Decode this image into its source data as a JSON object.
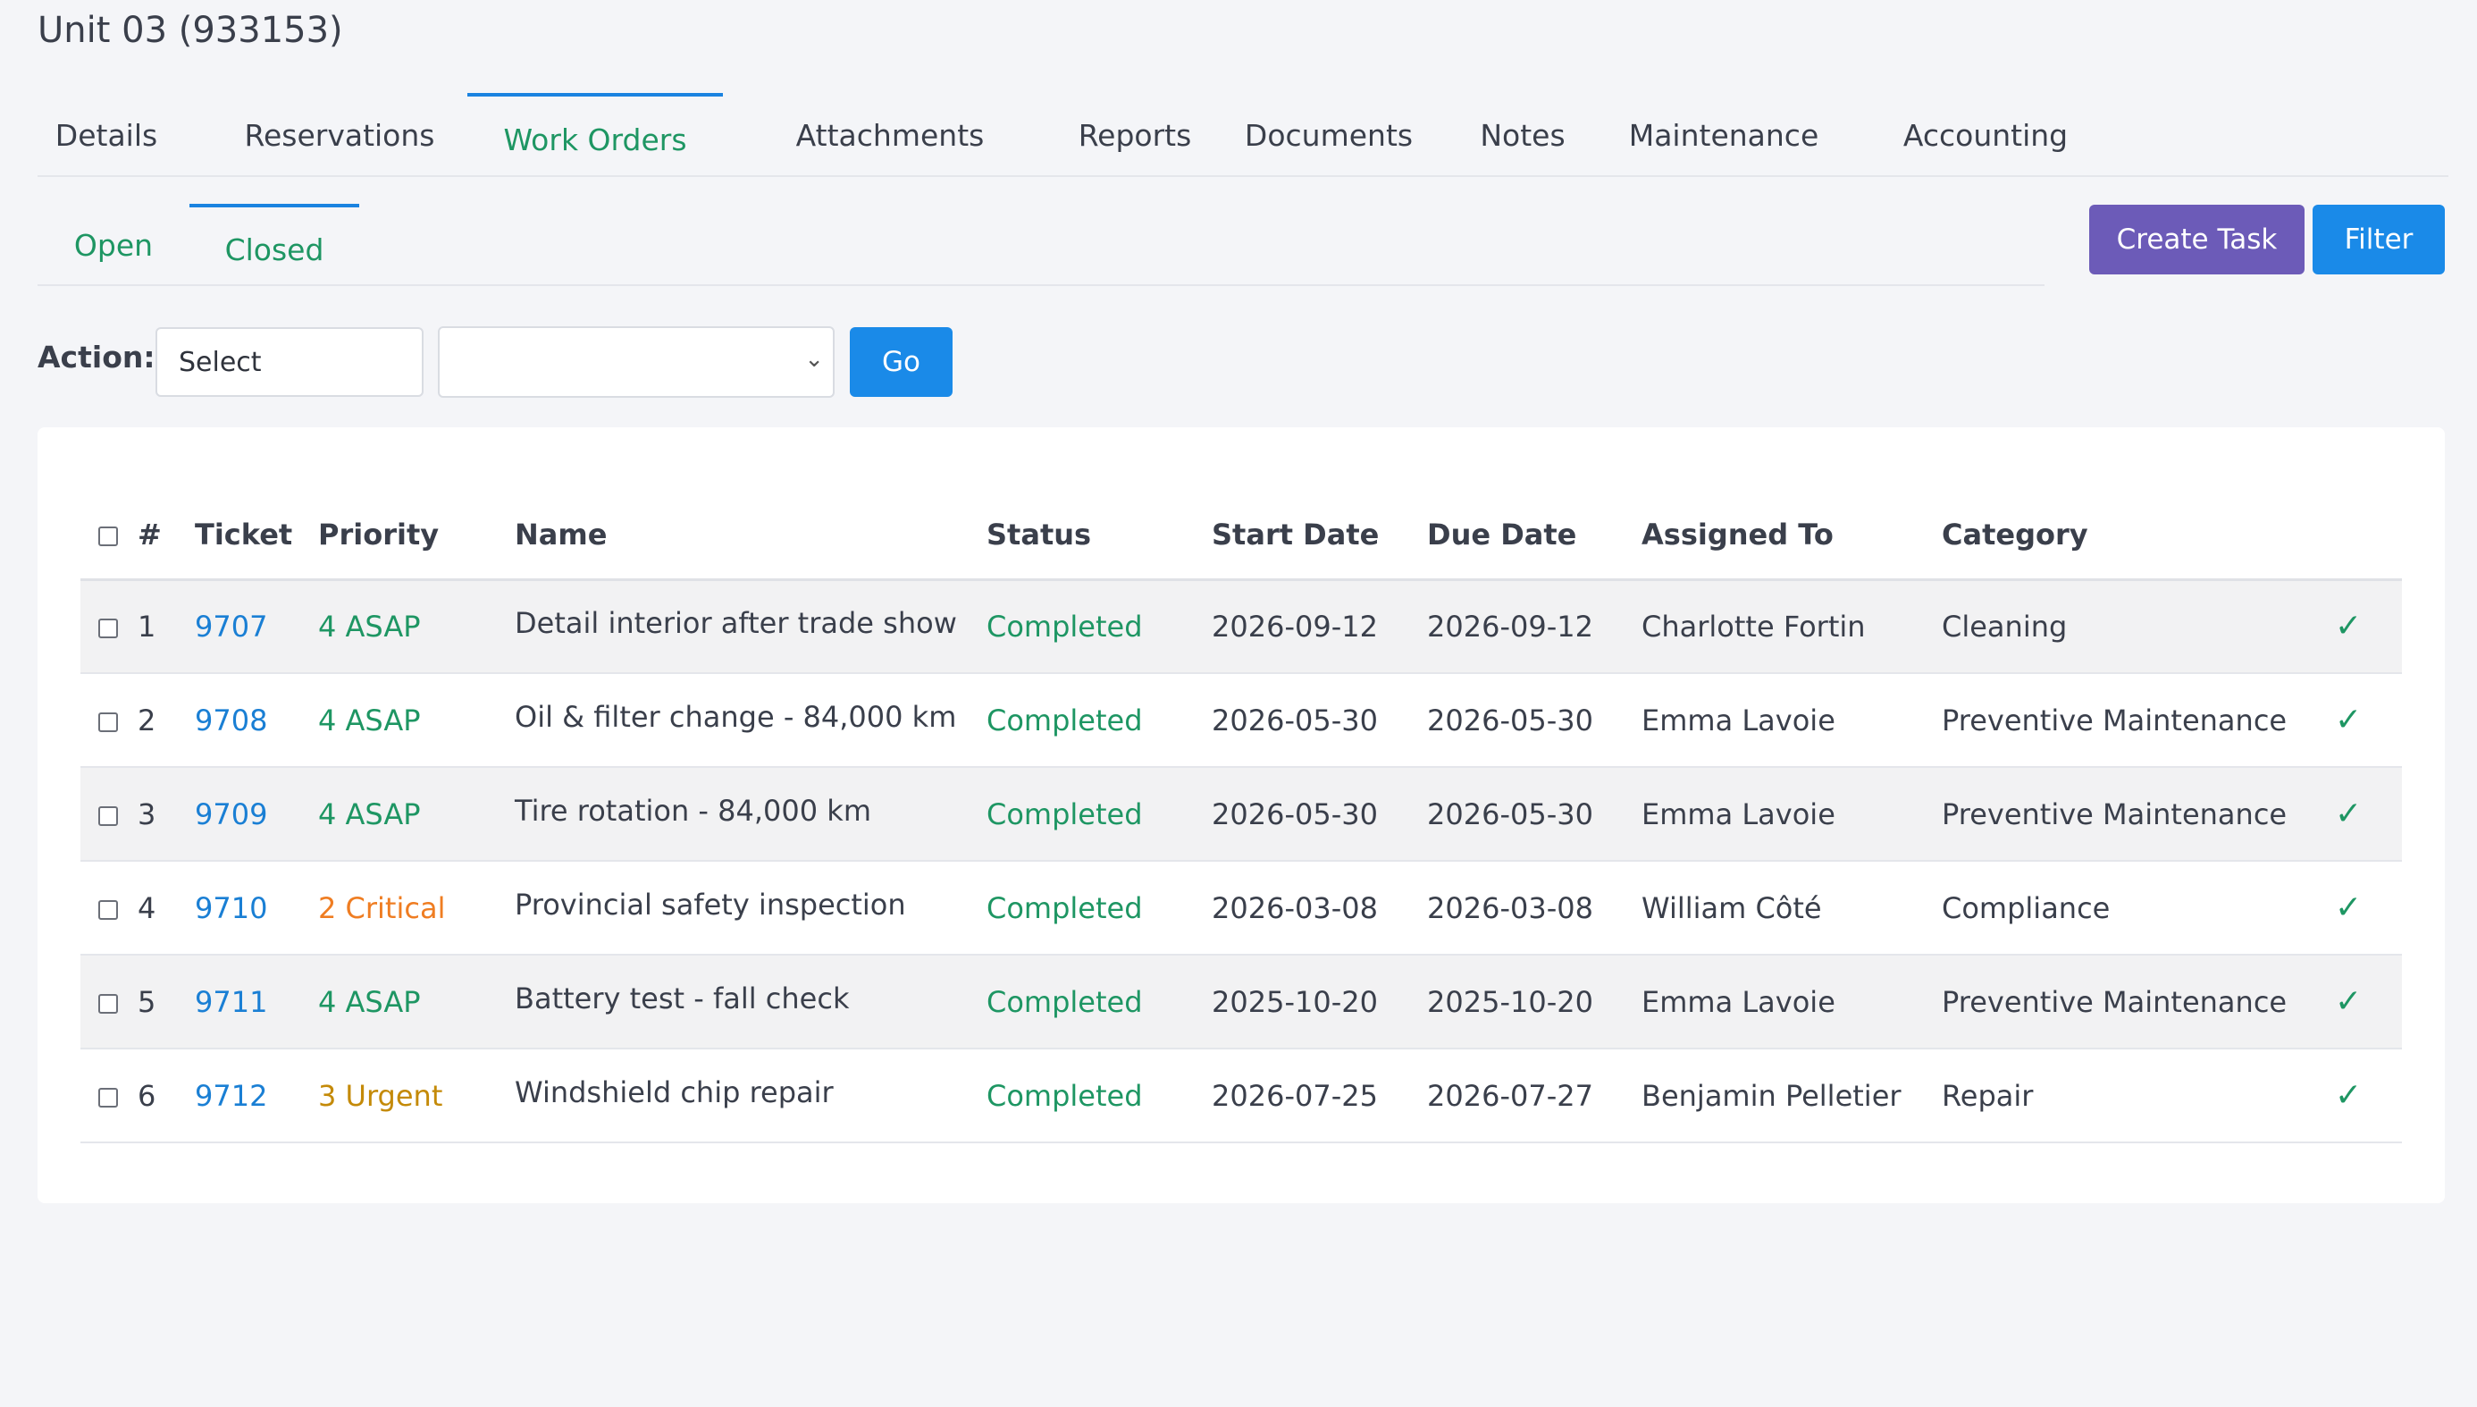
{
  "unit": {
    "title": "Unit 03 (933153)"
  },
  "tabs": [
    {
      "label": "Details"
    },
    {
      "label": "Reservations"
    },
    {
      "label": "Work Orders"
    },
    {
      "label": "Attachments"
    },
    {
      "label": "Reports"
    },
    {
      "label": "Documents"
    },
    {
      "label": "Notes"
    },
    {
      "label": "Maintenance"
    },
    {
      "label": "Accounting"
    }
  ],
  "subtabs": [
    {
      "label": "Open"
    },
    {
      "label": "Closed"
    }
  ],
  "buttons": {
    "create_task": "Create Task",
    "filter": "Filter",
    "go": "Go"
  },
  "action": {
    "label": "Action:",
    "select_value": "Select",
    "dropdown_value": ""
  },
  "table": {
    "headers": {
      "num": "#",
      "ticket": "Ticket",
      "priority": "Priority",
      "name": "Name",
      "status": "Status",
      "start": "Start Date",
      "due": "Due Date",
      "assigned": "Assigned To",
      "category": "Category"
    },
    "rows": [
      {
        "num": "1",
        "ticket": "9707",
        "priority": "4 ASAP",
        "name": "Detail interior after trade show",
        "status": "Completed",
        "start": "2026-09-12",
        "due": "2026-09-12",
        "assigned": "Charlotte Fortin",
        "category": "Cleaning"
      },
      {
        "num": "2",
        "ticket": "9708",
        "priority": "4 ASAP",
        "name": "Oil & filter change - 84,000 km",
        "status": "Completed",
        "start": "2026-05-30",
        "due": "2026-05-30",
        "assigned": "Emma Lavoie",
        "category": "Preventive Maintenance"
      },
      {
        "num": "3",
        "ticket": "9709",
        "priority": "4 ASAP",
        "name": "Tire rotation - 84,000 km",
        "status": "Completed",
        "start": "2026-05-30",
        "due": "2026-05-30",
        "assigned": "Emma Lavoie",
        "category": "Preventive Maintenance"
      },
      {
        "num": "4",
        "ticket": "9710",
        "priority": "2 Critical",
        "name": "Provincial safety inspection",
        "status": "Completed",
        "start": "2026-03-08",
        "due": "2026-03-08",
        "assigned": "William Côté",
        "category": "Compliance"
      },
      {
        "num": "5",
        "ticket": "9711",
        "priority": "4 ASAP",
        "name": "Battery test - fall check",
        "status": "Completed",
        "start": "2025-10-20",
        "due": "2025-10-20",
        "assigned": "Emma Lavoie",
        "category": "Preventive Maintenance"
      },
      {
        "num": "6",
        "ticket": "9712",
        "priority": "3 Urgent",
        "name": "Windshield chip repair",
        "status": "Completed",
        "start": "2026-07-25",
        "due": "2026-07-27",
        "assigned": "Benjamin Pelletier",
        "category": "Repair"
      }
    ]
  },
  "colors": {
    "accent_green": "#1e9663",
    "accent_blue": "#1a8ae8",
    "purple": "#6c5bb8",
    "critical": "#ef7d22",
    "urgent": "#c48a08"
  },
  "icons": {
    "row_status": "check-icon",
    "dropdown": "chevron-down-icon"
  }
}
